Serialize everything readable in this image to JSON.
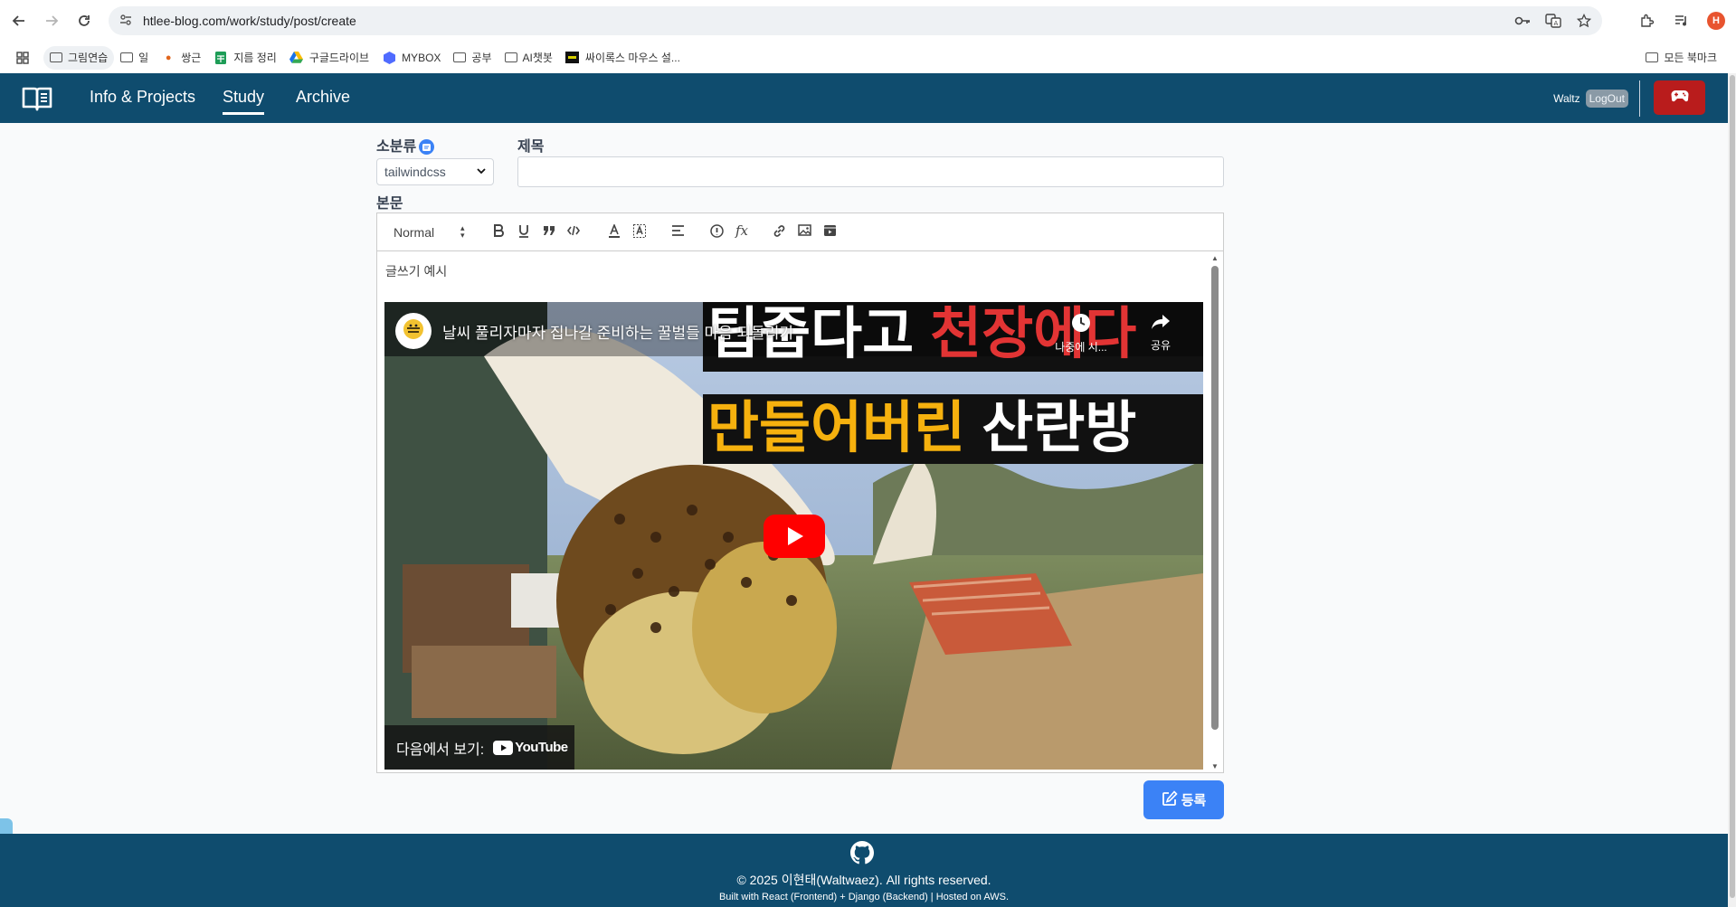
{
  "browser": {
    "url": "htlee-blog.com/work/study/post/create",
    "profile_initial": "H",
    "bookmarks": [
      "그림연습",
      "일",
      "쌍근",
      "지름 정리",
      "구글드라이브",
      "MYBOX",
      "공부",
      "AI챗봇",
      "싸이록스 마우스 설..."
    ],
    "all_bookmarks": "모든 북마크"
  },
  "header": {
    "nav": [
      "Info & Projects",
      "Study",
      "Archive"
    ],
    "active_nav": "Study",
    "user": "Waltz",
    "logout": "LogOut"
  },
  "form": {
    "category_label": "소분류",
    "category_value": "tailwindcss",
    "title_label": "제목",
    "title_value": "",
    "body_label": "본문",
    "toolbar_heading": "Normal"
  },
  "editor": {
    "text": "글쓰기 예시",
    "video": {
      "title": "날씨 풀리자마자 집나갈 준비하는 꿀벌들 마음 되돌리기",
      "watch_later": "나중에 시...",
      "share": "공유",
      "thumb_line1_a": "팁줍다고",
      "thumb_line1_b": "천장에다",
      "thumb_line2_a": "만들어버린",
      "thumb_line2_b": "산란방",
      "watch_on": "다음에서 보기:",
      "youtube": "YouTube"
    }
  },
  "submit_label": "등록",
  "footer": {
    "copyright": "© 2025 이현태(Waltwaez). All rights reserved.",
    "built": "Built with React (Frontend) + Django (Backend) | Hosted on AWS."
  },
  "colors": {
    "header_bg": "#0f4c6e",
    "accent_blue": "#3b82f6",
    "game_red": "#b91c1c"
  }
}
